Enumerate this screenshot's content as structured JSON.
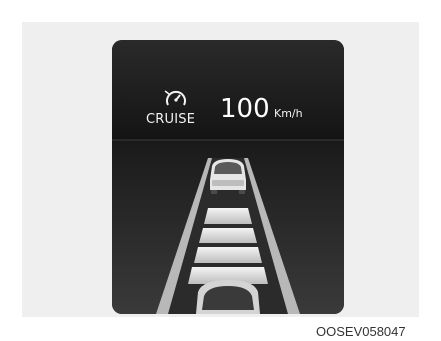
{
  "cluster": {
    "cruise_label": "CRUISE",
    "set_speed": "100",
    "speed_unit": "Km/h",
    "icon": "cruise-speedometer-icon"
  },
  "caption": {
    "image_code": "OOSEV058047"
  },
  "colors": {
    "screen_background": "#1f1f1f",
    "text": "#ffffff",
    "frame_background": "#efefef"
  }
}
